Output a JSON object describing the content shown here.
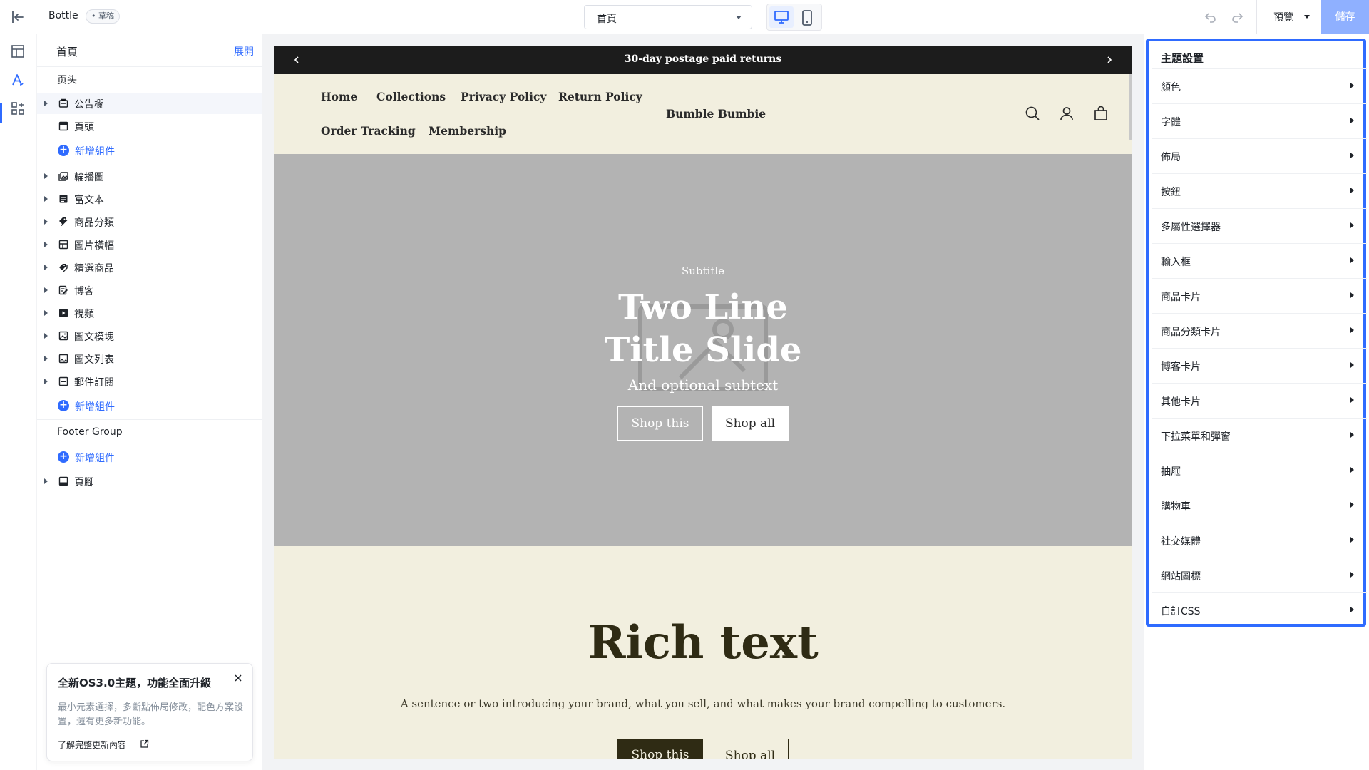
{
  "topbar": {
    "store_name": "Bottle",
    "draft_badge": "• 草稿",
    "page_select": "首頁",
    "preview_label": "預覽",
    "save_label": "儲存"
  },
  "left_panel": {
    "title": "首頁",
    "expand_label": "展開",
    "header_group_label": "页头",
    "header_items": [
      {
        "label": "公告欄",
        "icon": "announcement-icon"
      },
      {
        "label": "頁頭",
        "icon": "header-icon"
      }
    ],
    "add_component_label": "新增組件",
    "sections": [
      {
        "label": "輪播圖",
        "icon": "slideshow-icon"
      },
      {
        "label": "富文本",
        "icon": "rich-text-icon"
      },
      {
        "label": "商品分類",
        "icon": "collection-icon"
      },
      {
        "label": "圖片橫幅",
        "icon": "image-banner-icon"
      },
      {
        "label": "精選商品",
        "icon": "featured-product-icon"
      },
      {
        "label": "博客",
        "icon": "blog-icon"
      },
      {
        "label": "視頻",
        "icon": "video-icon"
      },
      {
        "label": "圖文模塊",
        "icon": "image-text-icon"
      },
      {
        "label": "圖文列表",
        "icon": "image-list-icon"
      },
      {
        "label": "郵件訂閱",
        "icon": "newsletter-icon"
      }
    ],
    "footer_group_label": "Footer Group",
    "footer_items": [
      {
        "label": "頁腳",
        "icon": "footer-icon"
      }
    ]
  },
  "notice": {
    "title": "全新OS3.0主題，功能全面升級",
    "body": "最小元素選擇，多斷點佈局修改，配色方案設置，還有更多新功能。",
    "link": "了解完整更新內容"
  },
  "storefront": {
    "announcement": "30-day postage paid returns",
    "nav_row1": [
      "Home",
      "Collections",
      "Privacy Policy",
      "Return Policy"
    ],
    "nav_row2": [
      "Order Tracking",
      "Membership"
    ],
    "brand": "Bumble Bumbie",
    "hero": {
      "subtitle": "Subtitle",
      "title_line1": "Two Line",
      "title_line2": "Title Slide",
      "subtext": "And optional subtext",
      "button_outline": "Shop this",
      "button_solid": "Shop all"
    },
    "rich_text": {
      "title": "Rich text",
      "body": "A sentence or two introducing your brand, what you sell, and what makes your brand compelling to customers.",
      "button_solid": "Shop this",
      "button_outline": "Shop all"
    }
  },
  "right_panel": {
    "title": "主題設置",
    "items": [
      "顏色",
      "字體",
      "佈局",
      "按鈕",
      "多屬性選擇器",
      "輸入框",
      "商品卡片",
      "商品分類卡片",
      "博客卡片",
      "其他卡片",
      "下拉菜單和彈窗",
      "抽屜",
      "購物車",
      "社交媒體",
      "網站圖標",
      "自訂CSS"
    ]
  },
  "colors": {
    "accent": "#2f6bff",
    "save_button": "#8fb0ff",
    "announcement_bar": "#1c1c1c",
    "storefront_bg": "#f2efdf",
    "hero_bg": "#b3b3b3",
    "rich_text_dark": "#2f2b14"
  }
}
